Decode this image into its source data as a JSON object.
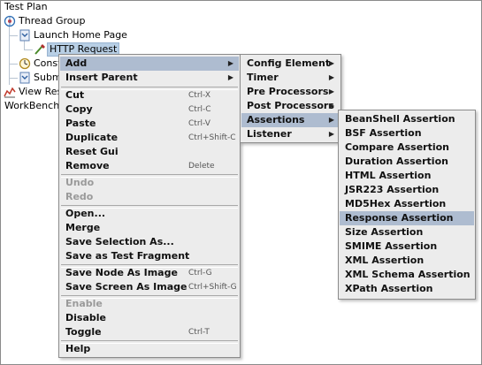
{
  "tree": {
    "items": [
      {
        "label": "Test Plan"
      },
      {
        "label": "Thread Group"
      },
      {
        "label": "Launch Home Page"
      },
      {
        "label": "HTTP Request"
      },
      {
        "label": "Const"
      },
      {
        "label": "Subm"
      },
      {
        "label": "View Res"
      },
      {
        "label": "WorkBench"
      }
    ]
  },
  "context_menu": {
    "items": [
      {
        "label": "Add"
      },
      {
        "label": "Insert Parent"
      },
      {
        "label": "Cut",
        "shortcut": "Ctrl-X"
      },
      {
        "label": "Copy",
        "shortcut": "Ctrl-C"
      },
      {
        "label": "Paste",
        "shortcut": "Ctrl-V"
      },
      {
        "label": "Duplicate",
        "shortcut": "Ctrl+Shift-C"
      },
      {
        "label": "Reset Gui"
      },
      {
        "label": "Remove",
        "shortcut": "Delete"
      },
      {
        "label": "Undo"
      },
      {
        "label": "Redo"
      },
      {
        "label": "Open..."
      },
      {
        "label": "Merge"
      },
      {
        "label": "Save Selection As..."
      },
      {
        "label": "Save as Test Fragment"
      },
      {
        "label": "Save Node As Image",
        "shortcut": "Ctrl-G"
      },
      {
        "label": "Save Screen As Image",
        "shortcut": "Ctrl+Shift-G"
      },
      {
        "label": "Enable"
      },
      {
        "label": "Disable"
      },
      {
        "label": "Toggle",
        "shortcut": "Ctrl-T"
      },
      {
        "label": "Help"
      }
    ]
  },
  "add_submenu": {
    "items": [
      {
        "label": "Config Element"
      },
      {
        "label": "Timer"
      },
      {
        "label": "Pre Processors"
      },
      {
        "label": "Post Processors"
      },
      {
        "label": "Assertions"
      },
      {
        "label": "Listener"
      }
    ]
  },
  "assertions_submenu": {
    "items": [
      {
        "label": "BeanShell Assertion"
      },
      {
        "label": "BSF Assertion"
      },
      {
        "label": "Compare Assertion"
      },
      {
        "label": "Duration Assertion"
      },
      {
        "label": "HTML Assertion"
      },
      {
        "label": "JSR223 Assertion"
      },
      {
        "label": "MD5Hex Assertion"
      },
      {
        "label": "Response Assertion"
      },
      {
        "label": "Size Assertion"
      },
      {
        "label": "SMIME Assertion"
      },
      {
        "label": "XML Assertion"
      },
      {
        "label": "XML Schema Assertion"
      },
      {
        "label": "XPath Assertion"
      }
    ]
  },
  "colors": {
    "menu_bg": "#ececec",
    "highlight": "#aebcd0",
    "disabled_text": "#9a9a9a",
    "tree_selection": "#b8cfe5"
  },
  "icons": [
    "thread-group-icon",
    "controller-icon",
    "sampler-icon",
    "timer-icon",
    "listener-icon",
    "submenu-arrow-icon"
  ]
}
